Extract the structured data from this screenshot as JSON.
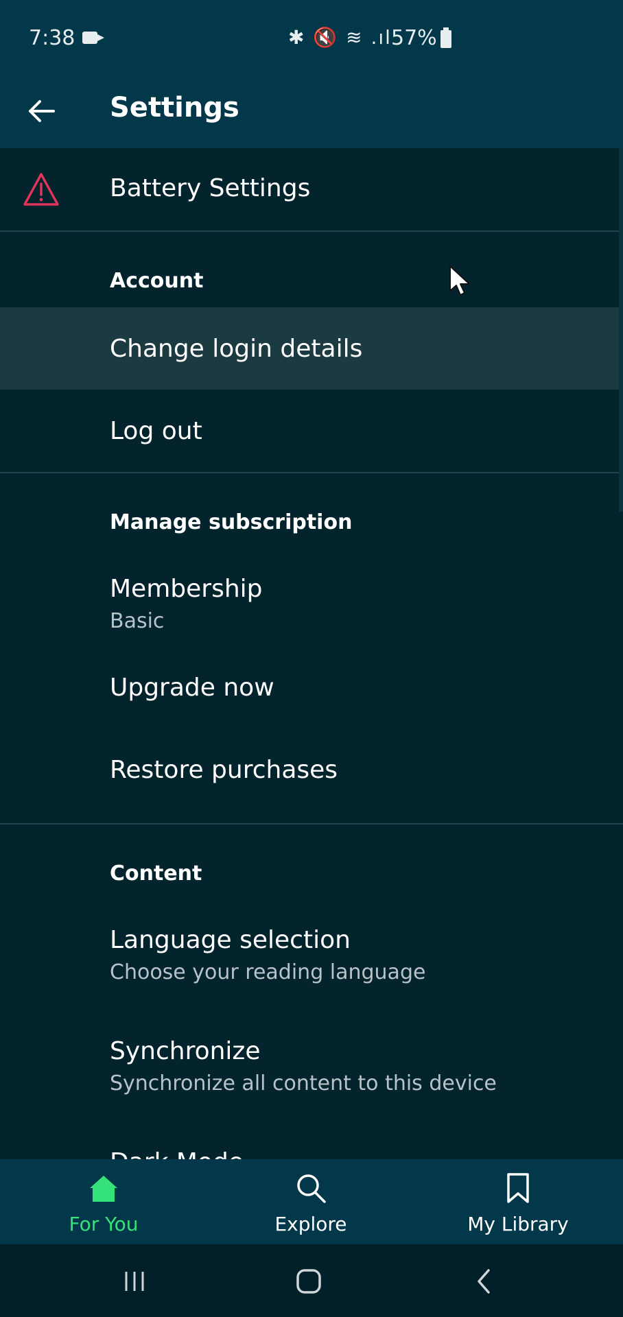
{
  "status_bar": {
    "time": "7:38",
    "icons": "✱ 🔇 ≋ .ıl",
    "battery": "57%"
  },
  "app_bar": {
    "title": "Settings"
  },
  "warning_row": {
    "label": "Battery Settings"
  },
  "sections": {
    "account": {
      "header": "Account",
      "items": [
        {
          "label": "Change login details"
        },
        {
          "label": "Log out"
        }
      ]
    },
    "subscription": {
      "header": "Manage subscription",
      "membership_label": "Membership",
      "membership_value": "Basic",
      "upgrade_label": "Upgrade now",
      "restore_label": "Restore purchases"
    },
    "content": {
      "header": "Content",
      "language_label": "Language selection",
      "language_sub": "Choose your reading language",
      "sync_label": "Synchronize",
      "sync_sub": "Synchronize all content to this device",
      "partial_label": "Dark Mode"
    }
  },
  "bottom_nav": {
    "items": [
      {
        "label": "For You",
        "icon": "home-icon",
        "active": true
      },
      {
        "label": "Explore",
        "icon": "search-icon",
        "active": false
      },
      {
        "label": "My Library",
        "icon": "bookmark-icon",
        "active": false
      }
    ]
  },
  "colors": {
    "background": "#03232d",
    "app_bar": "#03384a",
    "accent": "#35e27a",
    "warning": "#e0345a"
  }
}
